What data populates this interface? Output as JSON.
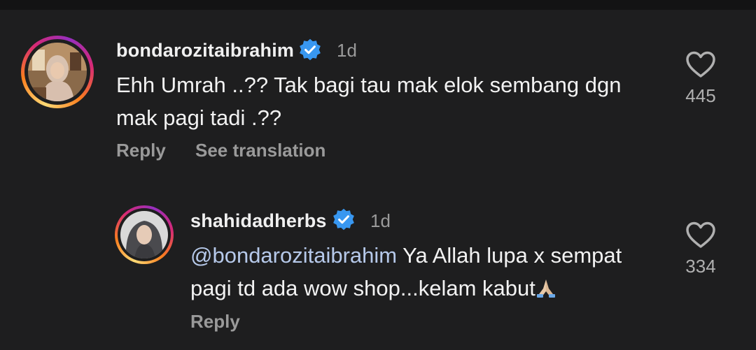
{
  "comments": [
    {
      "username": "bondarozitaibrahim",
      "time": "1d",
      "text": "Ehh Umrah ..?? Tak bagi tau mak elok sembang dgn",
      "text_line2": "mak pagi tadi .??",
      "reply_label": "Reply",
      "translate_label": "See translation",
      "like_count": "445"
    },
    {
      "username": "shahidadherbs",
      "time": "1d",
      "mention": "@bondarozitaibrahim",
      "text": " Ya Allah lupa x sempat",
      "text_line2": "pagi td ada wow shop...kelam kabut",
      "emoji": "folded-hands",
      "reply_label": "Reply",
      "like_count": "334"
    }
  ],
  "colors": {
    "background": "#1e1e1f",
    "verified": "#3897f0",
    "mention": "#b6c9ea",
    "secondary_text": "#9a9a9a"
  },
  "icons": [
    "heart-icon",
    "verified-badge-icon",
    "avatar"
  ]
}
